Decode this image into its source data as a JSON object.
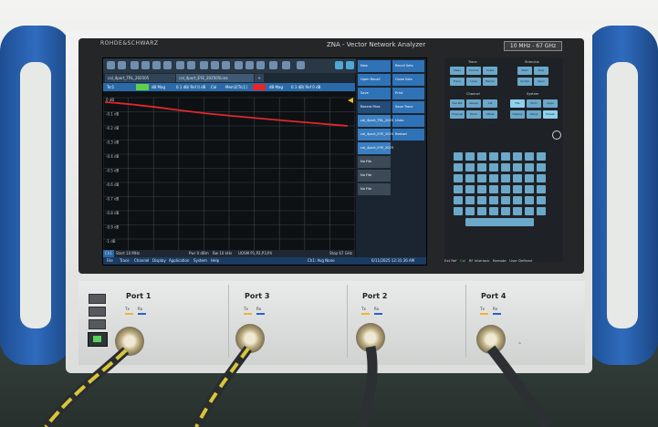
{
  "instrument": {
    "brand": "ROHDE&SCHWARZ",
    "model": "ZNA - Vector Network Analyzer",
    "freq_range": "10 MHz - 67 GHz"
  },
  "screen": {
    "tabs": [
      "cal_4port_TRL_202505",
      "cal_4port_EYE_202505Lina"
    ],
    "trace_info": [
      "Trc1",
      "dB Mag",
      "0.1 dB/ Ref 0 dB",
      "Cal",
      "Mem2[Trc1]",
      "dB Mag",
      "0.1 dB/ Ref 0 dB"
    ],
    "y_ticks": [
      "0 dB",
      "-0.1 dB",
      "-0.2 dB",
      "-0.3 dB",
      "-0.4 dB",
      "-0.5 dB",
      "-0.6 dB",
      "-0.7 dB",
      "-0.8 dB",
      "-0.9 dB",
      "-1 dB"
    ],
    "status": {
      "channel": "Ch1",
      "start": "Start 10 MHz",
      "pwr": "Pwr 0 dBm",
      "bw": "Bw 10 kHz",
      "uosm": "UOSM P1,P2,P3,P4",
      "stop": "Stop 67 GHz"
    },
    "menu": [
      "File",
      "Trace",
      "Channel",
      "Display",
      "Application",
      "System",
      "Help"
    ],
    "menu_status": "Ch1: Avg None",
    "timestamp": "6/11/2025 12:31:36 AM",
    "softkeys": {
      "top": [
        "New",
        "Recall Sets",
        "Open Recall",
        "Close Sets",
        "Save",
        "Print",
        "Save Trace",
        "Recent Files",
        "Undo",
        "Restart"
      ],
      "recent_label": "Recent Files",
      "recent_items": [
        "cal_4port_TRL_2025",
        "cal_4port_EYE_2025",
        "cal_4port_EYE_2025",
        "No File",
        "No File",
        "No File"
      ]
    }
  },
  "keypad": {
    "groups": [
      "Trace",
      "Stimulus",
      "Channel",
      "System"
    ],
    "trace_buttons": [
      "Meas",
      "Format",
      "Scale",
      "Trace Config",
      "Lines",
      "Marker"
    ],
    "stimulus_buttons": [
      "Start",
      "Stop",
      "Center",
      "Span"
    ],
    "channel_buttons": [
      "Pwr Bw Avg",
      "Sweep",
      "Cal",
      "Channel Config",
      "Mode",
      "Offset Embed"
    ],
    "system_buttons": [
      "File",
      "Print",
      "Apps",
      "Display",
      "Setup",
      "Preset"
    ]
  },
  "front_leds": [
    "Ext Ref",
    "Cal",
    "RF Interlock",
    "Remote",
    "User Defined"
  ],
  "ports": [
    {
      "label": "Port 1",
      "tx": "Tx",
      "rx": "Rx"
    },
    {
      "label": "Port 3",
      "tx": "Tx",
      "rx": "Rx"
    },
    {
      "label": "Port 2",
      "tx": "Tx",
      "rx": "Rx"
    },
    {
      "label": "Port 4",
      "tx": "Tx",
      "rx": "Rx"
    }
  ],
  "colors": {
    "handle_blue": "#2f6bbd",
    "trace_red": "#e0282d",
    "tx_orange": "#f2b233",
    "rx_blue": "#2d5fd1",
    "cable_yellow": "#d8c53a"
  }
}
